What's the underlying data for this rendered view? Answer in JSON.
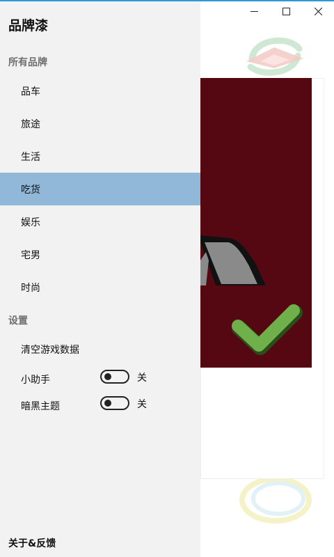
{
  "app": {
    "title": "品牌漆"
  },
  "window": {
    "minimize_icon": "minimize-icon",
    "maximize_icon": "maximize-icon",
    "close_icon": "close-icon"
  },
  "drawer": {
    "brands_header": "所有品牌",
    "categories": [
      {
        "label": "品车",
        "selected": false
      },
      {
        "label": "旅途",
        "selected": false
      },
      {
        "label": "生活",
        "selected": false
      },
      {
        "label": "吃货",
        "selected": true
      },
      {
        "label": "娱乐",
        "selected": false
      },
      {
        "label": "宅男",
        "selected": false
      },
      {
        "label": "时尚",
        "selected": false
      }
    ],
    "settings_header": "设置",
    "clear_data_label": "清空游戏数据",
    "toggles": [
      {
        "label": "小助手",
        "state": "关",
        "on": false
      },
      {
        "label": "暗黑主题",
        "state": "关",
        "on": false
      }
    ],
    "footer_label": "关于&反馈"
  },
  "colors": {
    "drawer_bg": "#f2f2f2",
    "selected_bg": "#91b7d9",
    "quiz_bg": "#560812",
    "check_green": "#6fb04a",
    "accent": "#2b9bd6"
  }
}
